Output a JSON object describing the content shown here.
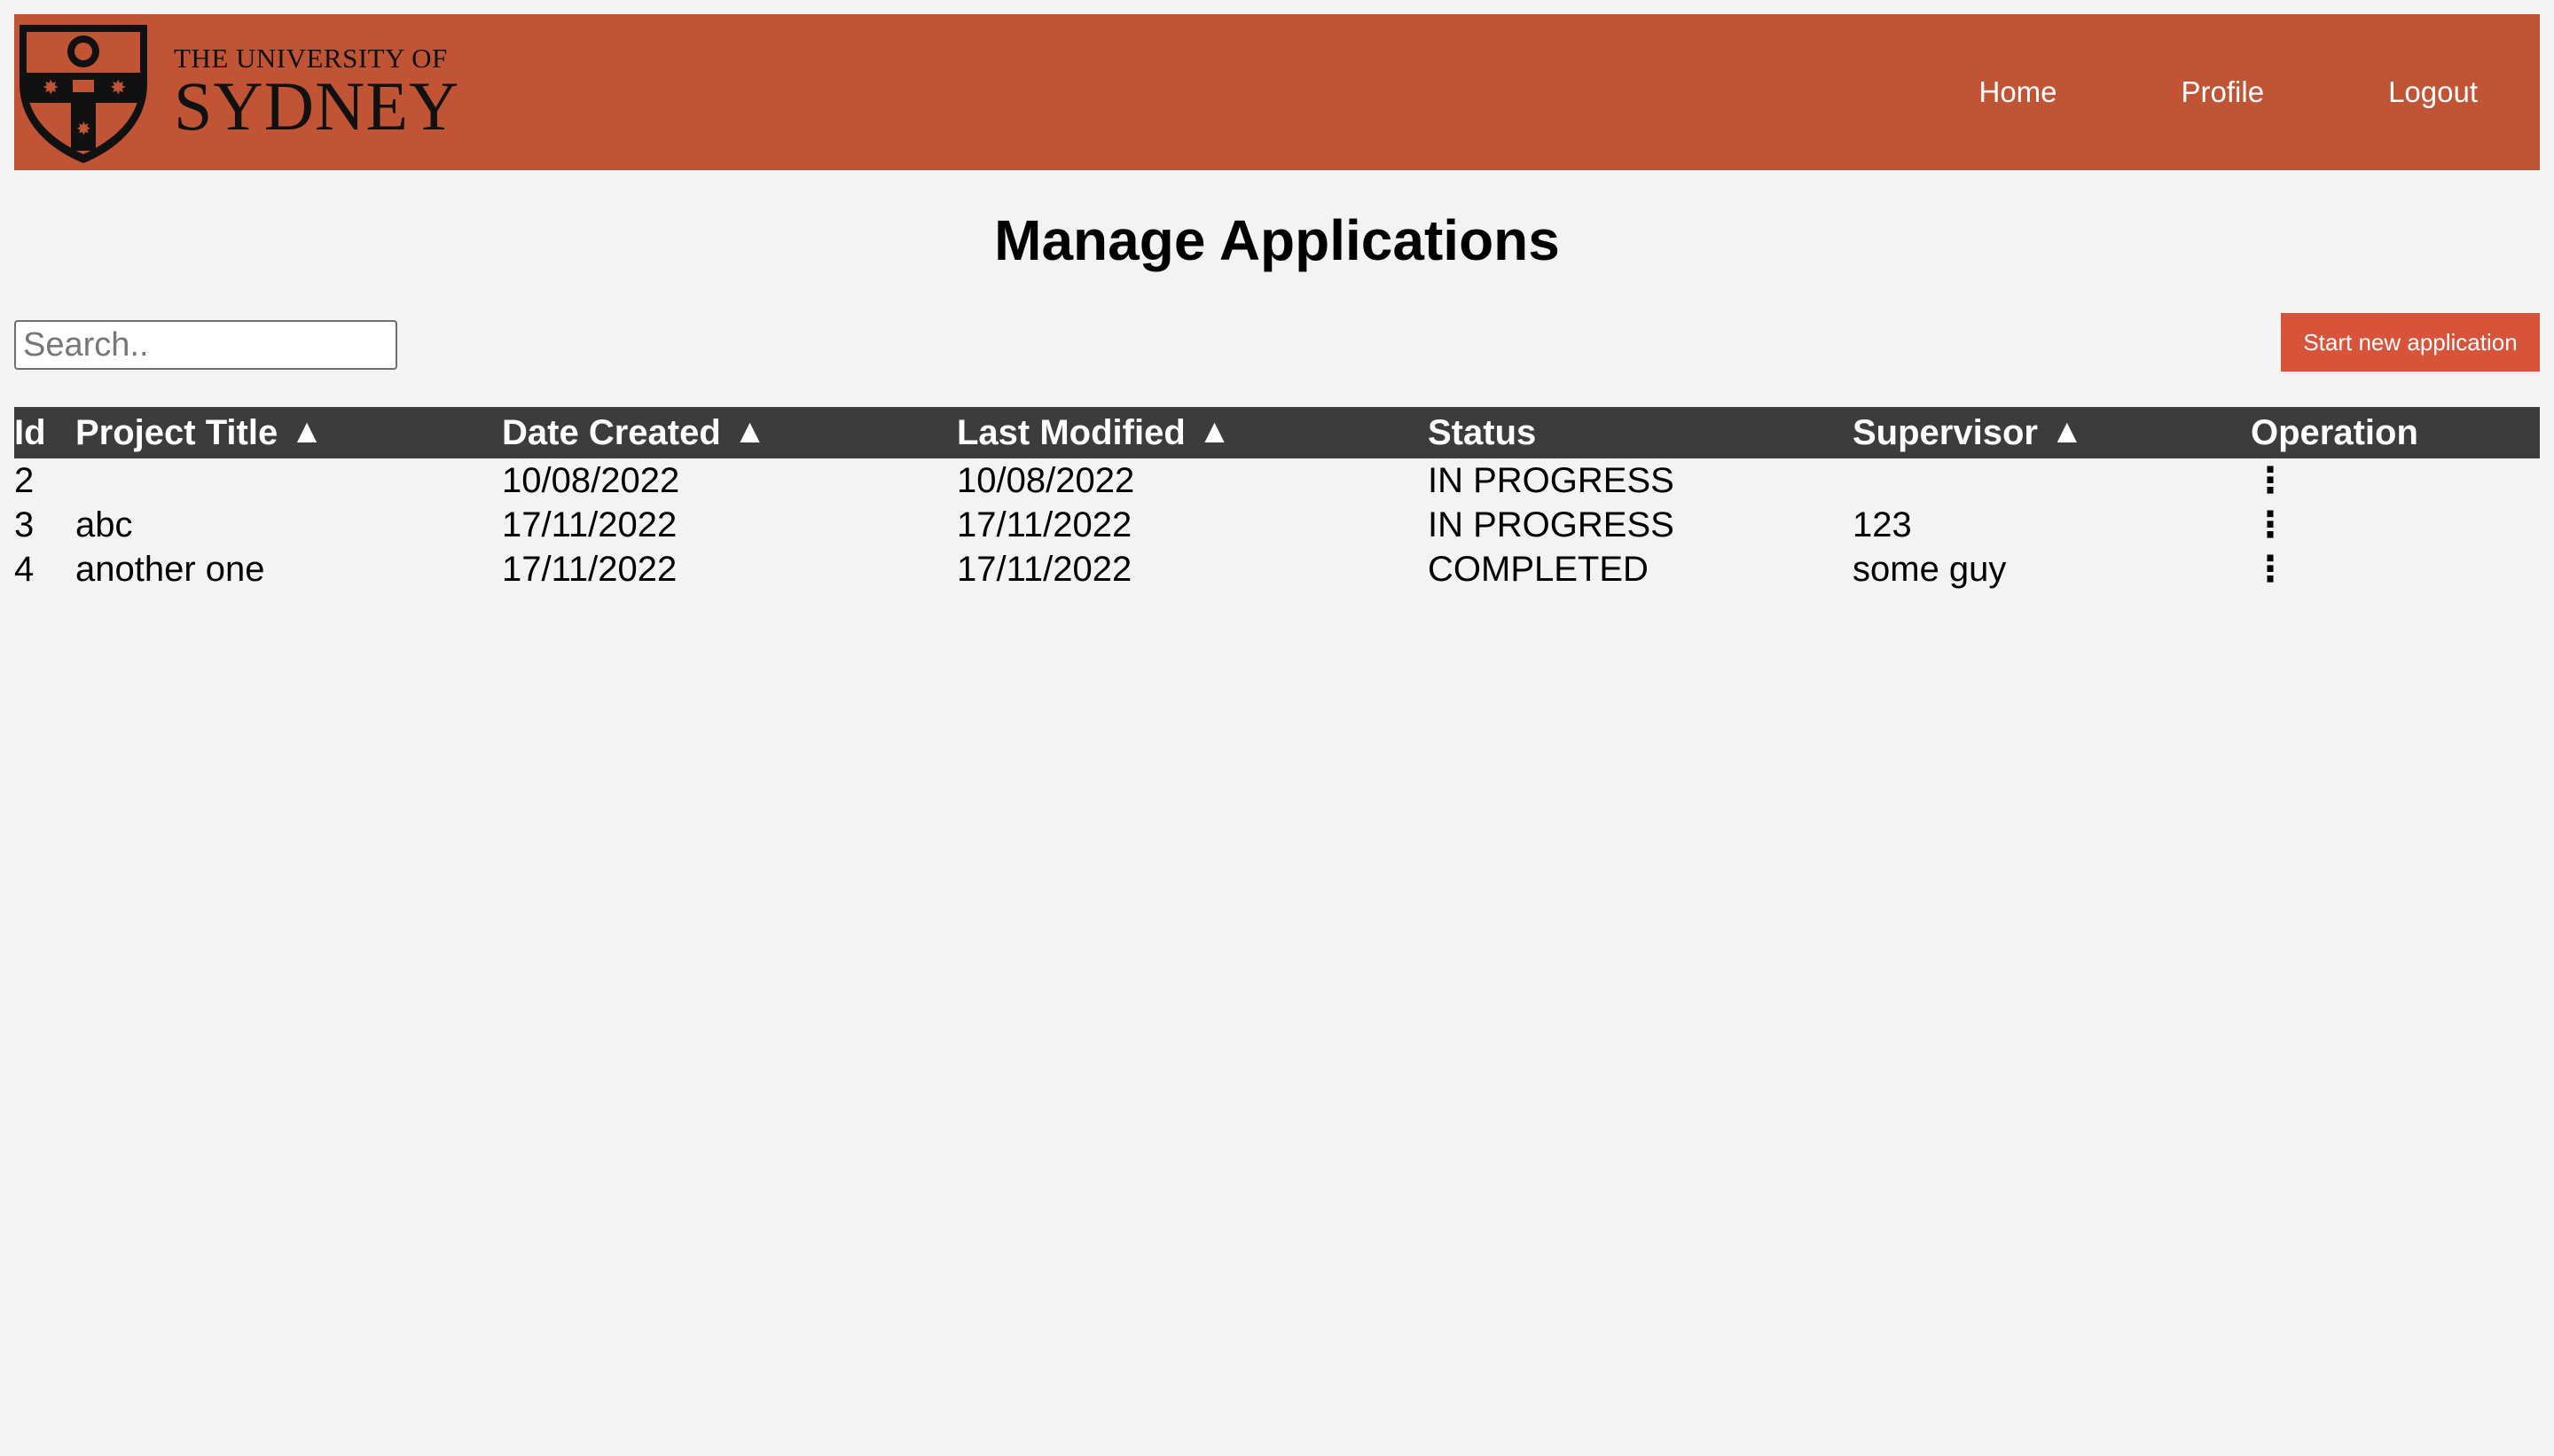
{
  "header": {
    "brand_small": "THE UNIVERSITY OF",
    "brand_big": "SYDNEY",
    "nav": [
      {
        "label": "Home"
      },
      {
        "label": "Profile"
      },
      {
        "label": "Logout"
      }
    ],
    "bg_color": "#c05434"
  },
  "page_title": "Manage Applications",
  "search": {
    "placeholder": "Search..",
    "value": ""
  },
  "start_button_label": "Start new application",
  "table": {
    "columns": [
      {
        "label": "Id",
        "sortable": false
      },
      {
        "label": "Project Title",
        "sortable": true
      },
      {
        "label": "Date Created",
        "sortable": true
      },
      {
        "label": "Last Modified",
        "sortable": true
      },
      {
        "label": "Status",
        "sortable": false
      },
      {
        "label": "Supervisor",
        "sortable": true
      },
      {
        "label": "Operation",
        "sortable": false
      }
    ],
    "sort_icon": "triangle-up-icon",
    "rows": [
      {
        "id": "2",
        "title": "",
        "created": "10/08/2022",
        "modified": "10/08/2022",
        "status": "IN PROGRESS",
        "supervisor": "",
        "operation": "⋮"
      },
      {
        "id": "3",
        "title": "abc",
        "created": "17/11/2022",
        "modified": "17/11/2022",
        "status": "IN PROGRESS",
        "supervisor": "123",
        "operation": "⋮"
      },
      {
        "id": "4",
        "title": "another one",
        "created": "17/11/2022",
        "modified": "17/11/2022",
        "status": "COMPLETED",
        "supervisor": "some guy",
        "operation": "⋮"
      }
    ]
  }
}
